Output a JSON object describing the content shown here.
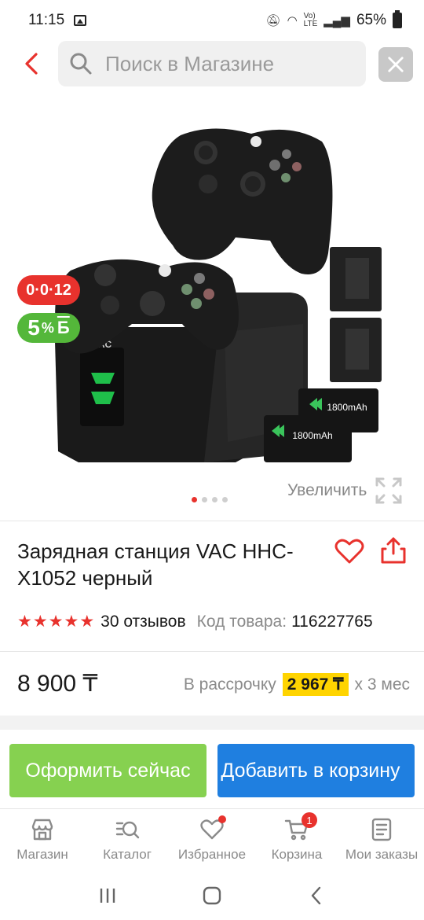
{
  "status_bar": {
    "time": "11:15",
    "battery": "65%"
  },
  "search": {
    "placeholder": "Поиск в Магазине"
  },
  "gallery": {
    "installment_badge": "0·0·12",
    "bonus_badge": {
      "value": "5",
      "percent": "%",
      "currency": "Б"
    },
    "zoom_label": "Увеличить",
    "image_count": 4,
    "active_index": 0,
    "battery_label": "1800mAh",
    "brand_label": "VAC"
  },
  "product": {
    "title": "Зарядная станция VAC HHC-X1052 черный",
    "rating": 5,
    "reviews": "30 отзывов",
    "code_label": "Код товара:",
    "code_value": "116227765",
    "price": "8 900 ₸",
    "installment_prefix": "В рассрочку",
    "installment_amount": "2 967 ₸",
    "installment_suffix": "х 3 мес"
  },
  "actions": {
    "buy_now": "Оформить сейчас",
    "add_to_cart": "Добавить в корзину"
  },
  "bottom_nav": {
    "items": [
      {
        "label": "Магазин"
      },
      {
        "label": "Каталог"
      },
      {
        "label": "Избранное"
      },
      {
        "label": "Корзина",
        "badge": "1"
      },
      {
        "label": "Мои заказы"
      }
    ]
  },
  "colors": {
    "accent_red": "#e8322d",
    "buy_green": "#86d150",
    "cart_blue": "#1f7fe0",
    "bonus_green": "#54b73a",
    "installment_yellow": "#ffd400"
  }
}
